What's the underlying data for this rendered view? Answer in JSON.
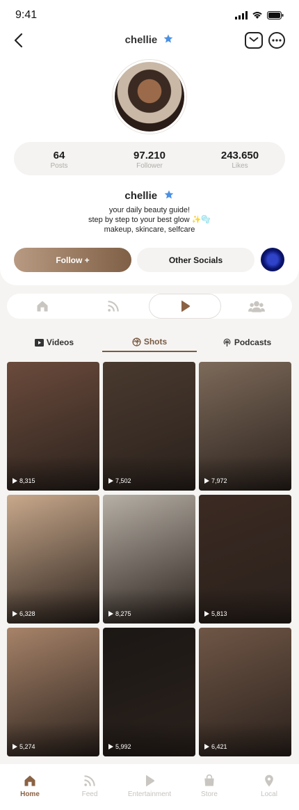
{
  "status_bar": {
    "time": "9:41"
  },
  "header": {
    "title": "chellie"
  },
  "stats": [
    {
      "value": "64",
      "label": "Posts"
    },
    {
      "value": "97.210",
      "label": "Follower"
    },
    {
      "value": "243.650",
      "label": "Likes"
    }
  ],
  "bio": {
    "name": "chellie",
    "lines": [
      "your daily beauty guide!",
      "step by step to your best glow ✨🫧",
      "makeup, skincare, selfcare"
    ]
  },
  "actions": {
    "follow_label": "Follow +",
    "socials_label": "Other Socials"
  },
  "sub_tabs": [
    {
      "label": "Videos",
      "icon": "video-icon"
    },
    {
      "label": "Shots",
      "icon": "shots-icon"
    },
    {
      "label": "Podcasts",
      "icon": "podcast-icon"
    }
  ],
  "active_sub_tab": "Shots",
  "shots": [
    {
      "views": "8,315",
      "color": "#6b4b3c"
    },
    {
      "views": "7,502",
      "color": "#4a3a2f"
    },
    {
      "views": "7,972",
      "color": "#7d6a5a"
    },
    {
      "views": "6,328",
      "color": "#c9a98c"
    },
    {
      "views": "8,275",
      "color": "#b7b0a6"
    },
    {
      "views": "5,813",
      "color": "#3b2a22"
    },
    {
      "views": "5,274",
      "color": "#a78369"
    },
    {
      "views": "5,992",
      "color": "#1b1714"
    },
    {
      "views": "6,421",
      "color": "#6f5646"
    }
  ],
  "bottom_nav": [
    {
      "label": "Home",
      "icon": "home-icon",
      "active": true
    },
    {
      "label": "Feed",
      "icon": "feed-icon",
      "active": false
    },
    {
      "label": "Entertainment",
      "icon": "play-icon",
      "active": false
    },
    {
      "label": "Store",
      "icon": "bag-icon",
      "active": false
    },
    {
      "label": "Local",
      "icon": "location-icon",
      "active": false
    }
  ],
  "colors": {
    "accent": "#7a5a43",
    "verified": "#4a90e2"
  }
}
